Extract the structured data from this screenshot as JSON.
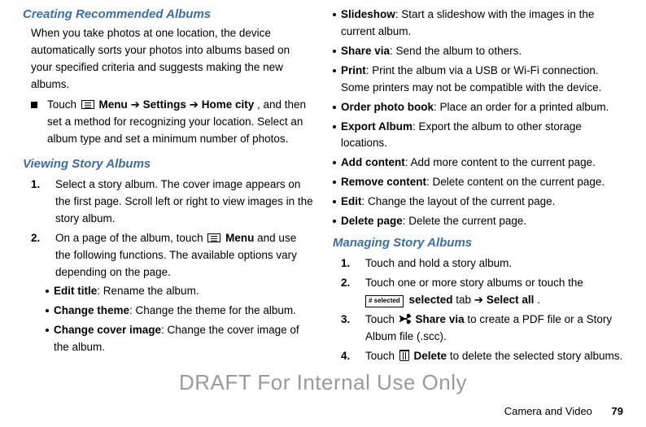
{
  "left": {
    "heading1": "Creating Recommended Albums",
    "para1": "When you take photos at one location, the device automatically sorts your photos into albums based on your specified criteria and suggests making the new albums.",
    "sq1_prefix": "Touch ",
    "sq1_menu": "Menu",
    "sq1_arrow1": " ➔ ",
    "sq1_settings": "Settings",
    "sq1_arrow2": " ➔ ",
    "sq1_homecity": "Home city",
    "sq1_rest": ", and then set a method for recognizing your location. Select an album type and set a minimum number of photos.",
    "heading2": "Viewing Story Albums",
    "step1_num": "1.",
    "step1_text": "Select a story album. The cover image appears on the first page. Scroll left or right to view images in the story album.",
    "step2_num": "2.",
    "step2_prefix": "On a page of the album, touch ",
    "step2_menu": "Menu",
    "step2_rest": " and use the following functions. The available options vary depending on the page.",
    "b1_term": "Edit title",
    "b1_text": ": Rename the album.",
    "b2_term": "Change theme",
    "b2_text": ": Change the theme for the album.",
    "b3_term": "Change cover image",
    "b3_text": ": Change the cover image of the album."
  },
  "right": {
    "b4_term": "Slideshow",
    "b4_text": ": Start a slideshow with the images in the current album.",
    "b5_term": "Share via",
    "b5_text": ": Send the album to others.",
    "b6_term": "Print",
    "b6_text": ": Print the album via a USB or Wi-Fi connection. Some printers may not be compatible with the device.",
    "b7_term": "Order photo book",
    "b7_text": ": Place an order for a printed album.",
    "b8_term": "Export Album",
    "b8_text": ": Export the album to other storage locations.",
    "b9_term": "Add content",
    "b9_text": ": Add more content to the current page.",
    "b10_term": "Remove content",
    "b10_text": ": Delete content on the current page.",
    "b11_term": "Edit",
    "b11_text": ": Change the layout of the current page.",
    "b12_term": "Delete page",
    "b12_text": ": Delete the current page.",
    "heading3": "Managing Story Albums",
    "m1_num": "1.",
    "m1_text": "Touch and hold a story album.",
    "m2_num": "2.",
    "m2_prefix": "Touch one or more story albums or touch the ",
    "m2_tag": "# selected",
    "m2_selected": "selected",
    "m2_tab": " tab ➔ ",
    "m2_selectall": "Select all",
    "m2_dot": ".",
    "m3_num": "3.",
    "m3_prefix": "Touch ",
    "m3_sharevia": "Share via",
    "m3_rest": " to create a PDF file or a Story Album file (.scc).",
    "m4_num": "4.",
    "m4_prefix": "Touch ",
    "m4_delete": "Delete",
    "m4_rest": " to delete the selected story albums."
  },
  "watermark": "DRAFT For Internal Use Only",
  "footer_section": "Camera and Video",
  "footer_page": "79"
}
